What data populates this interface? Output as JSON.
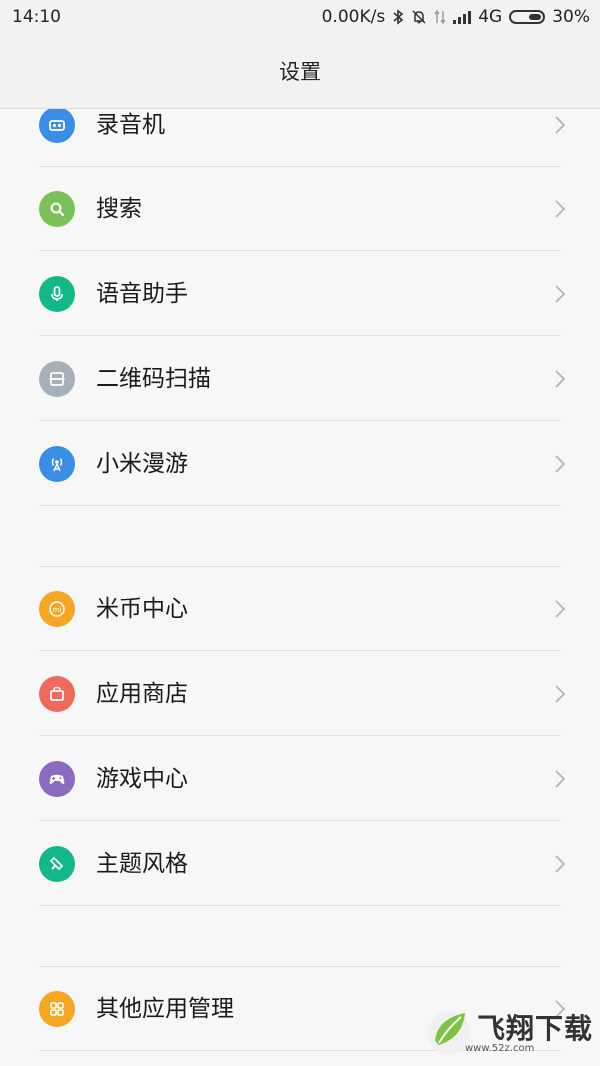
{
  "status": {
    "time": "14:10",
    "speed": "0.00K/s",
    "network": "4G",
    "battery": "30%"
  },
  "header": {
    "title": "设置"
  },
  "groups": [
    {
      "items": [
        {
          "label": "录音机",
          "icon": "recorder-icon",
          "color": "#3a8ee6"
        },
        {
          "label": "搜索",
          "icon": "search-icon",
          "color": "#7cc05a"
        },
        {
          "label": "语音助手",
          "icon": "microphone-icon",
          "color": "#13b889"
        },
        {
          "label": "二维码扫描",
          "icon": "qr-scan-icon",
          "color": "#a7b0ba"
        },
        {
          "label": "小米漫游",
          "icon": "roaming-antenna-icon",
          "color": "#3a8ee6"
        }
      ]
    },
    {
      "items": [
        {
          "label": "米币中心",
          "icon": "mi-coin-icon",
          "color": "#f5a623"
        },
        {
          "label": "应用商店",
          "icon": "app-store-bag-icon",
          "color": "#ef6a5c"
        },
        {
          "label": "游戏中心",
          "icon": "gamepad-icon",
          "color": "#8a6bbf"
        },
        {
          "label": "主题风格",
          "icon": "theme-brush-icon",
          "color": "#13b889"
        }
      ]
    },
    {
      "items": [
        {
          "label": "其他应用管理",
          "icon": "apps-grid-icon",
          "color": "#f5a623"
        }
      ]
    }
  ],
  "watermark": {
    "brand": "飞翔下载",
    "url": "www.52z.com"
  }
}
